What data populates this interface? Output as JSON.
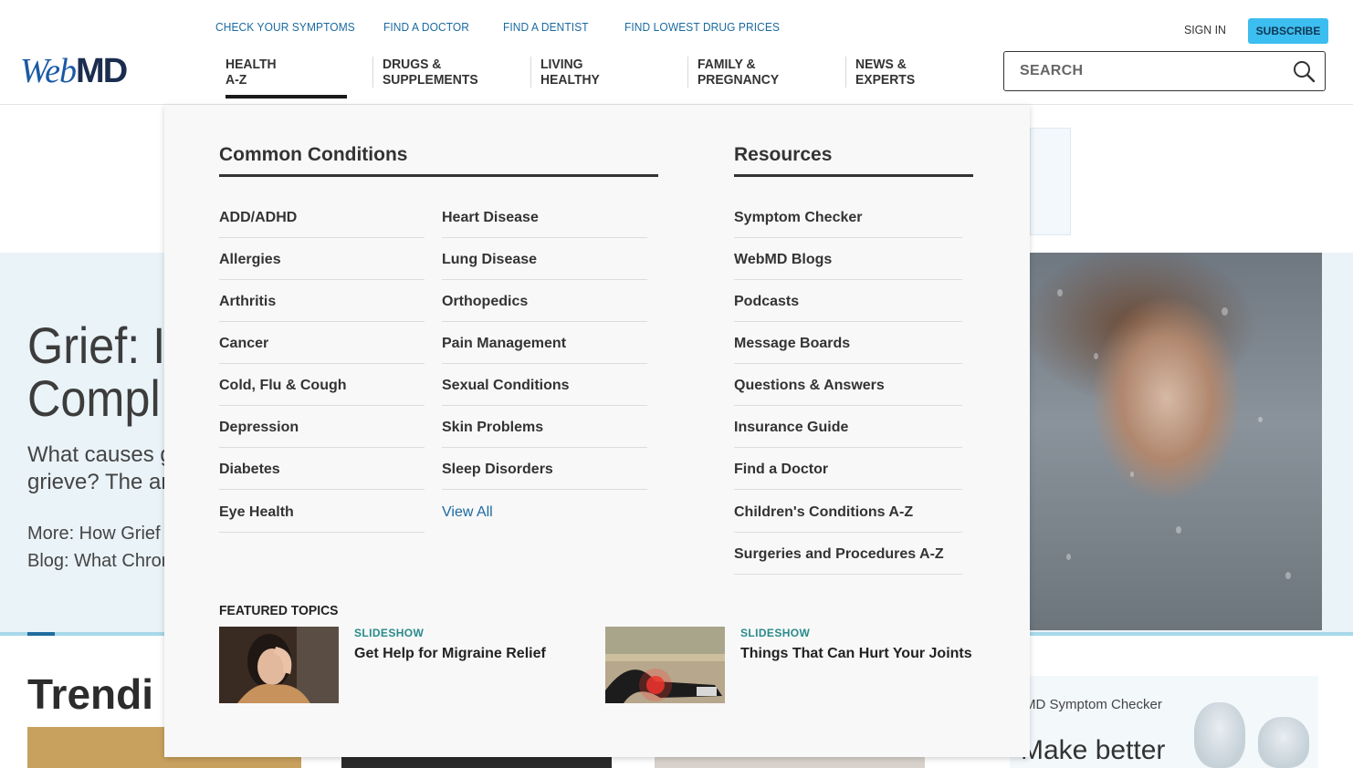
{
  "brand": {
    "logo_web": "Web",
    "logo_md": "MD"
  },
  "top_links": [
    "CHECK YOUR SYMPTOMS",
    "FIND A DOCTOR",
    "FIND A DENTIST",
    "FIND LOWEST DRUG PRICES"
  ],
  "account": {
    "sign_in": "SIGN IN",
    "subscribe": "SUBSCRIBE"
  },
  "search": {
    "placeholder": "SEARCH"
  },
  "nav": [
    {
      "line1": "HEALTH",
      "line2": "A-Z",
      "active": true
    },
    {
      "line1": "DRUGS &",
      "line2": "SUPPLEMENTS"
    },
    {
      "line1": "LIVING",
      "line2": "HEALTHY"
    },
    {
      "line1": "FAMILY &",
      "line2": "PREGNANCY"
    },
    {
      "line1": "NEWS &",
      "line2": "EXPERTS"
    }
  ],
  "menu": {
    "conditions_heading": "Common Conditions",
    "conditions_col1": [
      "ADD/ADHD",
      "Allergies",
      "Arthritis",
      "Cancer",
      "Cold, Flu & Cough",
      "Depression",
      "Diabetes",
      "Eye Health"
    ],
    "conditions_col2": [
      "Heart Disease",
      "Lung Disease",
      "Orthopedics",
      "Pain Management",
      "Sexual Conditions",
      "Skin Problems",
      "Sleep Disorders"
    ],
    "view_all": "View All",
    "resources_heading": "Resources",
    "resources": [
      "Symptom Checker",
      "WebMD Blogs",
      "Podcasts",
      "Message Boards",
      "Questions & Answers",
      "Insurance Guide",
      "Find a Doctor",
      "Children's Conditions A-Z",
      "Surgeries and Procedures A-Z"
    ],
    "featured_heading": "FEATURED TOPICS",
    "featured": [
      {
        "tag": "SLIDESHOW",
        "title": "Get Help for Migraine Relief"
      },
      {
        "tag": "SLIDESHOW",
        "title": "Things That Can Hurt Your Joints"
      }
    ]
  },
  "background": {
    "hero_title_1": "Grief: I",
    "hero_title_2": "Compl",
    "hero_sub_1": "What causes g",
    "hero_sub_2": "grieve? The an",
    "hero_more": "More: How Grief S",
    "hero_blog": "Blog: What Chron",
    "trending": "Trendi",
    "symptom_card_title": "MD Symptom Checker",
    "symptom_card_sub": "Make better"
  },
  "colors": {
    "accent": "#3dbef0",
    "link": "#1b6aa0",
    "tag": "#2a8a8a",
    "logo_blue": "#1a5aa6"
  }
}
